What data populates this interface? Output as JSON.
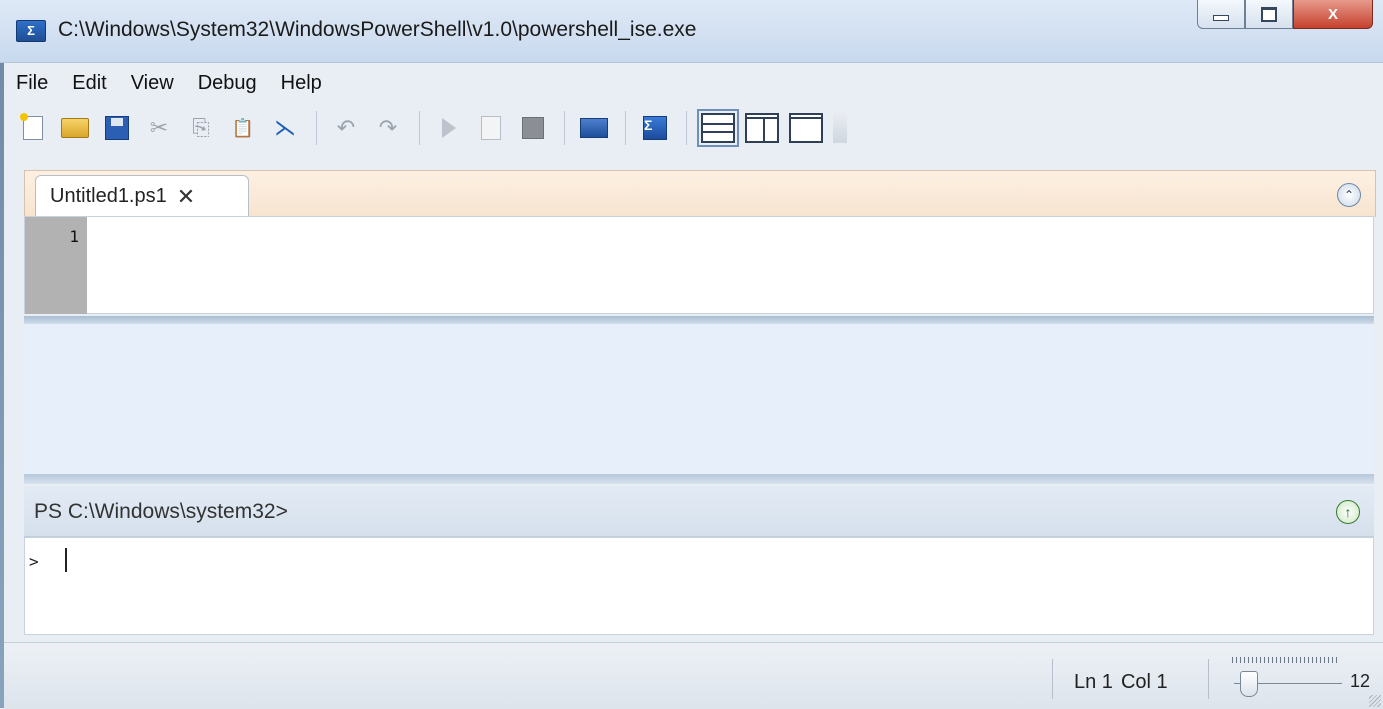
{
  "window": {
    "title": "C:\\Windows\\System32\\WindowsPowerShell\\v1.0\\powershell_ise.exe",
    "app_icon_glyph": "Σ",
    "buttons": {
      "minimize": "",
      "maximize": "",
      "close": "X"
    }
  },
  "menu": {
    "items": [
      {
        "label": "File"
      },
      {
        "label": "Edit"
      },
      {
        "label": "View"
      },
      {
        "label": "Debug"
      },
      {
        "label": "Help"
      }
    ]
  },
  "toolbar": {
    "icons": [
      "new-script",
      "open",
      "save",
      "cut",
      "copy",
      "paste",
      "clear",
      "undo",
      "redo",
      "run",
      "run-selection",
      "stop",
      "remote-powershell",
      "start-powershell",
      "layout-top",
      "layout-right",
      "layout-max",
      "more"
    ],
    "glyphs": {
      "cut": "✂",
      "copy": "⎘",
      "paste": "📋",
      "clear": "⋋",
      "undo": "↶",
      "redo": "↷"
    }
  },
  "editor": {
    "tabs": [
      {
        "label": "Untitled1.ps1",
        "close": "✕"
      }
    ],
    "collapse_glyph": "⌃",
    "line_numbers": [
      "1"
    ]
  },
  "console": {
    "prompt": "PS C:\\Windows\\system32>",
    "prompt_button_glyph": "↑",
    "input_prompt": ">",
    "input_value": ""
  },
  "status": {
    "ln": "Ln 1",
    "col": "Col 1",
    "zoom": "12"
  },
  "colors": {
    "tab_strip": "#f7e4d0",
    "output_pane": "#e7f0fa",
    "close_button": "#c5412e"
  }
}
